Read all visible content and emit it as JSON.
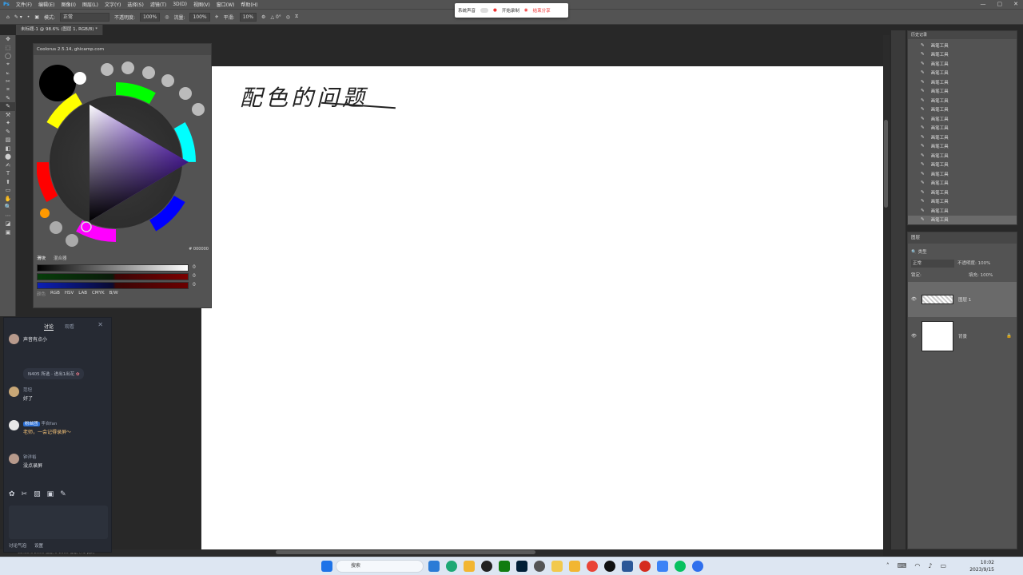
{
  "menu": [
    "文件(F)",
    "编辑(E)",
    "图像(I)",
    "图层(L)",
    "文字(Y)",
    "选择(S)",
    "滤镜(T)",
    "3D(D)",
    "视图(V)",
    "窗口(W)",
    "帮助(H)"
  ],
  "window_controls": [
    "—",
    "▢",
    "✕"
  ],
  "options": {
    "mode_label": "模式:",
    "mode_value": "正常",
    "opacity_label": "不透明度:",
    "opacity_value": "100%",
    "flow_label": "流量:",
    "flow_value": "100%",
    "smooth_label": "平滑:",
    "smooth_value": "10%",
    "angle_value": "0°"
  },
  "document_tab": "未标题-1 @ 98.6% (图层 1, RGB/8) *",
  "canvas_handwriting": "配色的问题",
  "coolorus": {
    "title": "Coolorus 2.5.14, ghicamp.com",
    "hex": "# 000000",
    "tabs": [
      "滑块",
      "混合器"
    ],
    "sliders": [
      {
        "value": "0"
      },
      {
        "value": "0"
      },
      {
        "value": "0"
      }
    ],
    "modes": [
      "颜色",
      "RGB",
      "HSV",
      "LAB",
      "CMYK",
      "B/W"
    ]
  },
  "chat": {
    "tabs": [
      "讨论",
      "观看"
    ],
    "messages": [
      {
        "name": "",
        "text": "声音有点小"
      },
      {
        "name": "范坦",
        "text": "好了"
      },
      {
        "name": "李自fan",
        "badge": "粉丝团",
        "text": "老师，一会记得录屏～"
      },
      {
        "name": "钟洋裕",
        "text": "没点录屏"
      }
    ],
    "notice": "N405 所选 · 进出1出花",
    "footer": [
      "讨论气泡",
      "设置"
    ]
  },
  "recorder": {
    "system_sound": "系统声音",
    "start": "开始录制",
    "end": "结束分享"
  },
  "history": {
    "title": "历史记录",
    "item": "画笔工具",
    "count": 20
  },
  "layers": {
    "title": "图层",
    "kind_label": "类型",
    "blend": "正常",
    "opacity_label": "不透明度:",
    "opacity_value": "100%",
    "lock_label": "锁定:",
    "fill_label": "填充:",
    "fill_value": "100%",
    "items": [
      {
        "name": "图层 1"
      },
      {
        "name": "背景"
      }
    ]
  },
  "statusbar": "98.63%   2000 像素 x 1600 像素 (72 ppi)",
  "taskbar": {
    "search": "搜索",
    "time": "10:02",
    "date": "2023/9/15"
  }
}
